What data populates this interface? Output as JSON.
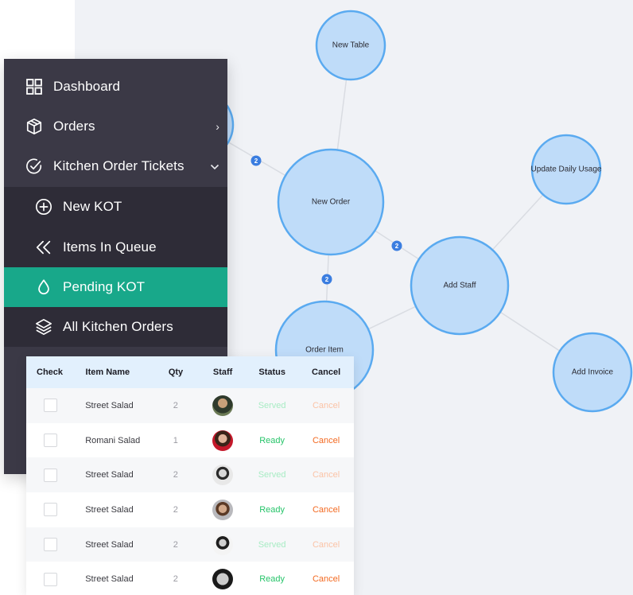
{
  "sidebar": {
    "items": [
      {
        "label": "Dashboard",
        "icon": "grid-icon"
      },
      {
        "label": "Orders",
        "icon": "box-icon",
        "chevron": "›"
      },
      {
        "label": "Kitchen Order Tickets",
        "icon": "check-circle-icon",
        "chevron": "⌄"
      },
      {
        "label": "New KOT",
        "icon": "plus-circle-icon"
      },
      {
        "label": "Items In Queue",
        "icon": "double-chevron-left-icon"
      },
      {
        "label": "Pending KOT",
        "icon": "drop-icon",
        "active": true
      },
      {
        "label": "All Kitchen Orders",
        "icon": "layers-icon"
      }
    ],
    "active_color": "#18a88a"
  },
  "graph": {
    "nodes": [
      {
        "id": "new-table",
        "label": "New Table"
      },
      {
        "id": "hidden-node",
        "label": ""
      },
      {
        "id": "new-order",
        "label": "New Order"
      },
      {
        "id": "update-daily-usage",
        "label": "Update Daily Usage"
      },
      {
        "id": "add-staff",
        "label": "Add Staff"
      },
      {
        "id": "order-item",
        "label": "Order Item"
      },
      {
        "id": "add-invoice",
        "label": "Add Invoice"
      }
    ],
    "edges": [
      {
        "from": "new-table",
        "to": "new-order"
      },
      {
        "from": "hidden-node",
        "to": "new-order",
        "badge": "2"
      },
      {
        "from": "new-order",
        "to": "add-staff",
        "badge": "2"
      },
      {
        "from": "new-order",
        "to": "order-item",
        "badge": "2"
      },
      {
        "from": "add-staff",
        "to": "update-daily-usage"
      },
      {
        "from": "add-staff",
        "to": "order-item"
      },
      {
        "from": "add-staff",
        "to": "add-invoice"
      }
    ]
  },
  "table": {
    "headers": {
      "check": "Check",
      "item": "Item Name",
      "qty": "Qty",
      "staff": "Staff",
      "status": "Status",
      "cancel": "Cancel"
    },
    "rows": [
      {
        "item": "Street Salad",
        "qty": "2",
        "status": "Served",
        "cancel": "Cancel",
        "state": "served"
      },
      {
        "item": "Romani Salad",
        "qty": "1",
        "status": "Ready",
        "cancel": "Cancel",
        "state": "ready"
      },
      {
        "item": "Street Salad",
        "qty": "2",
        "status": "Served",
        "cancel": "Cancel",
        "state": "served"
      },
      {
        "item": "Street Salad",
        "qty": "2",
        "status": "Ready",
        "cancel": "Cancel",
        "state": "ready"
      },
      {
        "item": "Street Salad",
        "qty": "2",
        "status": "Served",
        "cancel": "Cancel",
        "state": "served"
      },
      {
        "item": "Street Salad",
        "qty": "2",
        "status": "Ready",
        "cancel": "Cancel",
        "state": "ready"
      }
    ],
    "colors": {
      "served": "#a8ecc4",
      "ready": "#27c46a",
      "cancel_active": "#f36a22",
      "cancel_muted": "#fbc3a6"
    }
  }
}
